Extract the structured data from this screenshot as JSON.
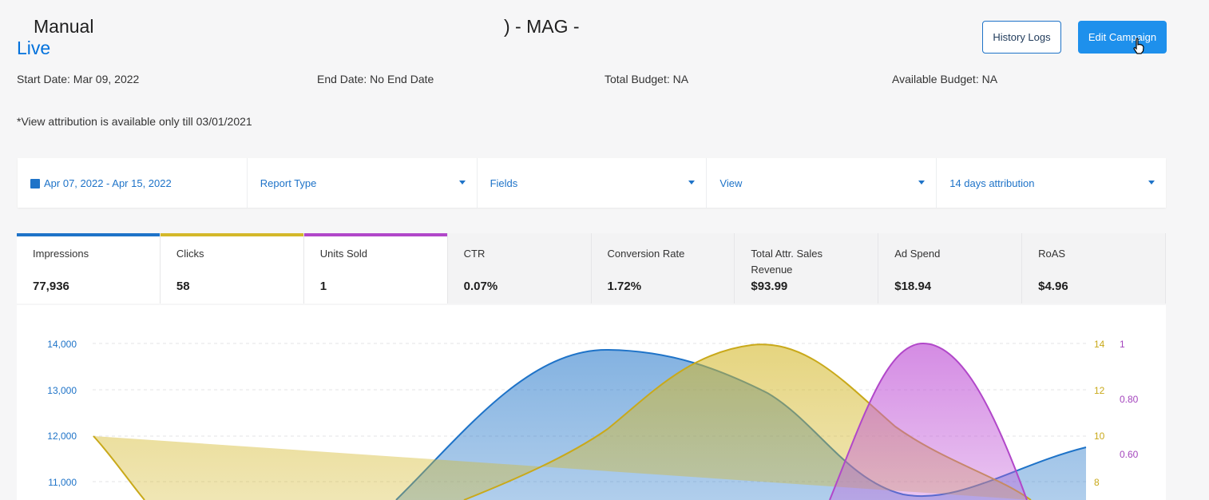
{
  "header": {
    "title_left": "Manual",
    "title_right": ") - MAG -",
    "status": "Live",
    "history_logs_label": "History Logs",
    "edit_campaign_label": "Edit Campaign",
    "start_date": "Start Date: Mar 09, 2022",
    "end_date": "End Date: No End Date",
    "total_budget": "Total Budget: NA",
    "available_budget": "Available Budget: NA",
    "note": "*View attribution is available only till 03/01/2021"
  },
  "filters": {
    "date_range": "Apr 07, 2022 - Apr 15, 2022",
    "report_type": "Report Type",
    "fields": "Fields",
    "view": "View",
    "attribution": "14 days attribution"
  },
  "metrics": [
    {
      "label": "Impressions",
      "value": "77,936",
      "color": "#1e73c8",
      "selected": true
    },
    {
      "label": "Clicks",
      "value": "58",
      "color": "#d4b82a",
      "selected": true
    },
    {
      "label": "Units Sold",
      "value": "1",
      "color": "#b147c9",
      "selected": true
    },
    {
      "label": "CTR",
      "value": "0.07%",
      "selected": false
    },
    {
      "label": "Conversion Rate",
      "value": "1.72%",
      "selected": false
    },
    {
      "label": "Total Attr. Sales Revenue",
      "value": "$93.99",
      "selected": false
    },
    {
      "label": "Ad Spend",
      "value": "$18.94",
      "selected": false
    },
    {
      "label": "RoAS",
      "value": "$4.96",
      "selected": false
    }
  ],
  "chart_data": {
    "type": "area",
    "y_left_ticks": [
      "14,000",
      "13,000",
      "12,000",
      "11,000"
    ],
    "y_right_clicks_ticks": [
      "14",
      "12",
      "10",
      "8"
    ],
    "y_right_units_ticks": [
      "1",
      "0.80",
      "0.60"
    ],
    "series": [
      {
        "name": "Impressions",
        "color": "#1e73c8"
      },
      {
        "name": "Clicks",
        "color": "#d4b82a"
      },
      {
        "name": "Units Sold",
        "color": "#b147c9"
      }
    ]
  }
}
